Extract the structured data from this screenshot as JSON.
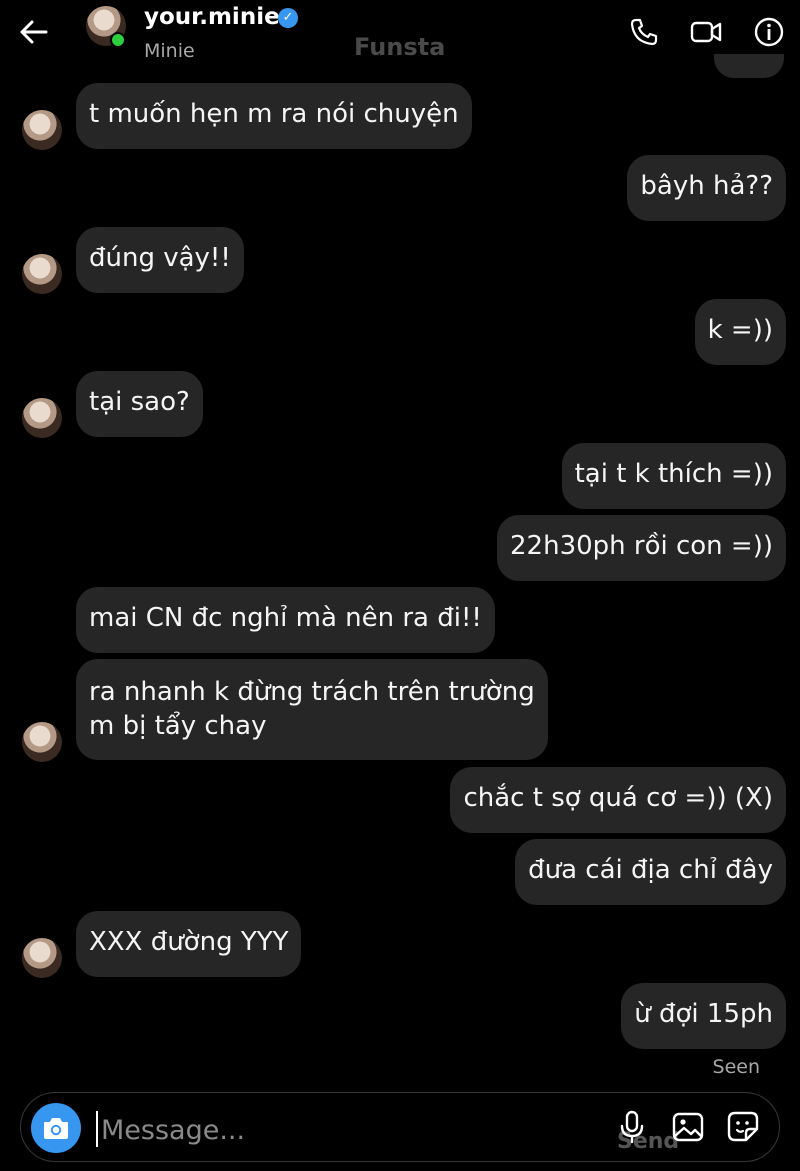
{
  "header": {
    "username": "your.minie",
    "display_name": "Minie",
    "watermark": "Funsta",
    "verified_icon": "verified-badge-icon",
    "icons": [
      "back-arrow-icon",
      "phone-icon",
      "video-icon",
      "info-icon"
    ]
  },
  "messages": [
    {
      "side": "left",
      "text": "t muốn hẹn m ra nói chuyện"
    },
    {
      "side": "right",
      "text": "bâyh hả??"
    },
    {
      "side": "left",
      "text": "đúng vậy!!"
    },
    {
      "side": "right",
      "text": "k =))"
    },
    {
      "side": "left",
      "text": "tại sao?"
    },
    {
      "side": "right",
      "text": "tại t k thích =))"
    },
    {
      "side": "right",
      "text": "22h30ph rồi con =))"
    },
    {
      "side": "left",
      "text": "mai CN đc nghỉ mà nên ra đi!!"
    },
    {
      "side": "left",
      "text": "ra nhanh k đừng trách trên trường",
      "text2": "m bị tẩy chay"
    },
    {
      "side": "right",
      "text": "chắc t sợ quá cơ =)) (X)"
    },
    {
      "side": "right",
      "text": "đưa cái địa chỉ đây"
    },
    {
      "side": "left",
      "text": "XXX đường YYY"
    },
    {
      "side": "right",
      "text": "ừ đợi 15ph"
    }
  ],
  "status": {
    "seen": "Seen"
  },
  "composer": {
    "placeholder": "Message...",
    "send_ghost": "Send",
    "icons": [
      "camera-icon",
      "microphone-icon",
      "gallery-icon",
      "sticker-icon"
    ]
  },
  "colors": {
    "background": "#000000",
    "bubble": "#262626",
    "accent": "#3797f0",
    "online": "#2ecc40"
  }
}
